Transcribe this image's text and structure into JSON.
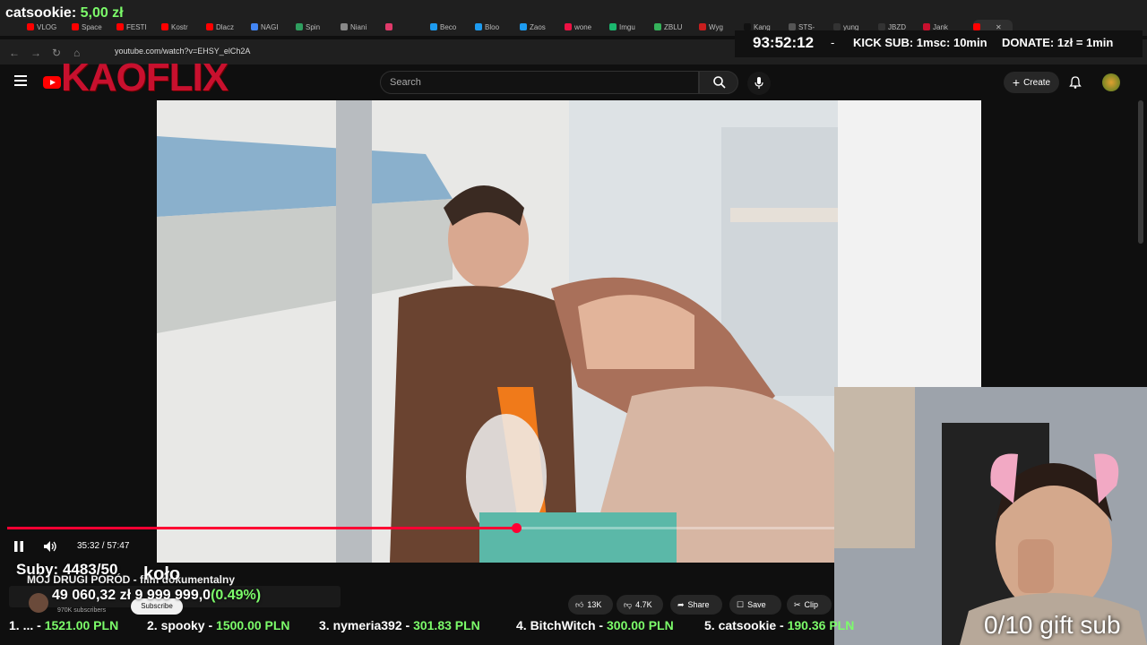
{
  "browser": {
    "tabs": [
      "VLOG",
      "Space",
      "FESTI",
      "Kostr",
      "Dlacz",
      "NAGI",
      "Spin",
      "Niani",
      "",
      "Beco",
      "Bloo",
      "Zaos",
      "wone",
      "Imgu",
      "ZBLU",
      "Wyg",
      "Kang",
      "STS-",
      "yung",
      "JBZD",
      "Jank"
    ],
    "url": "youtube.com/watch?v=EHSY_elCh2A"
  },
  "overlay": {
    "donor_name": "catsookie:",
    "donor_amount": "5,00 zł",
    "timer": "93:52:12",
    "dash": "-",
    "kick_sub": "KICK SUB: 1msc: 10min",
    "donate": "DONATE: 1zł = 1min",
    "subs": "Suby: 4483/50",
    "kolo": "koło",
    "goal_current": "49 060,32 zł",
    "goal_target": "9 999 999,0",
    "goal_percent": "(0.49%)",
    "gift_sub": "0/10 gift sub",
    "leaderboard": [
      {
        "rank": "1. ...",
        "amount": "1521.00 PLN"
      },
      {
        "rank": "2. spooky",
        "amount": "1500.00 PLN"
      },
      {
        "rank": "3. nymeria392",
        "amount": "301.83 PLN"
      },
      {
        "rank": "4. BitchWitch",
        "amount": "300.00 PLN"
      },
      {
        "rank": "5. catsookie",
        "amount": "190.36 PLN"
      }
    ]
  },
  "youtube": {
    "brand": "KAOFLIX",
    "search_placeholder": "Search",
    "create_label": "Create",
    "video_title": "MÓJ DRUGI PORÓD - film dokumentalny",
    "timecode": "35:32 / 57:47",
    "progress_fraction": 0.6149,
    "subscriber_count": "970K subscribers",
    "subscribe_label": "Subscribe",
    "likes": "13K",
    "dislikes": "4.7K",
    "share_label": "Share",
    "save_label": "Save",
    "clip_label": "Clip"
  },
  "icons": {
    "menu": "menu-icon",
    "search": "search-icon",
    "mic": "mic-icon",
    "bell": "bell-icon",
    "pause": "pause-icon",
    "volume": "volume-icon"
  },
  "colors": {
    "accent_red": "#ff0033",
    "brand_red": "#c8102e",
    "money_green": "#7cfc6a"
  }
}
